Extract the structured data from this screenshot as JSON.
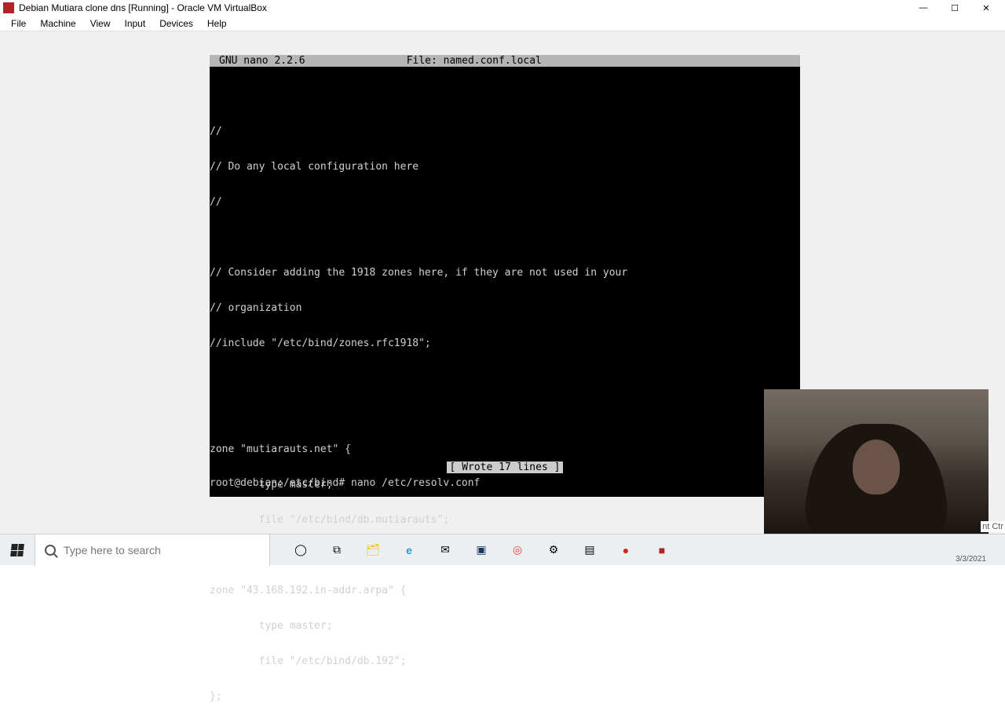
{
  "window": {
    "title": "Debian Mutiara  clone dns [Running] - Oracle VM VirtualBox"
  },
  "menus": [
    "File",
    "Machine",
    "View",
    "Input",
    "Devices",
    "Help"
  ],
  "terminal": {
    "editor_title_left": "  GNU nano 2.2.6",
    "editor_title_center": "File: named.conf.local",
    "lines": [
      "",
      "//",
      "// Do any local configuration here",
      "//",
      "",
      "// Consider adding the 1918 zones here, if they are not used in your",
      "// organization",
      "//include \"/etc/bind/zones.rfc1918\";",
      "",
      "",
      "zone \"mutiarauts.net\" {",
      "        type master;",
      "        file \"/etc/bind/db.mutiarauts\";",
      "};",
      "zone \"43.168.192.in-addr.arpa\" {",
      "        type master;",
      "        file \"/etc/bind/db.192\";",
      "};"
    ],
    "status": "[ Wrote 17 lines ]",
    "prompt": "root@debian:/etc/bind# nano /etc/resolv.conf"
  },
  "taskbar": {
    "search_placeholder": "Type here to search",
    "clip_hint": "nt Ctr",
    "date": "3/3/2021"
  },
  "icons": {
    "cortana": "◯",
    "taskview": "⧉",
    "explorer": "🗂",
    "edge": "e",
    "mail": "✉",
    "vbox": "▣",
    "chrome": "◎",
    "settings": "⚙",
    "more": "▤",
    "record": "●",
    "app": "■"
  }
}
